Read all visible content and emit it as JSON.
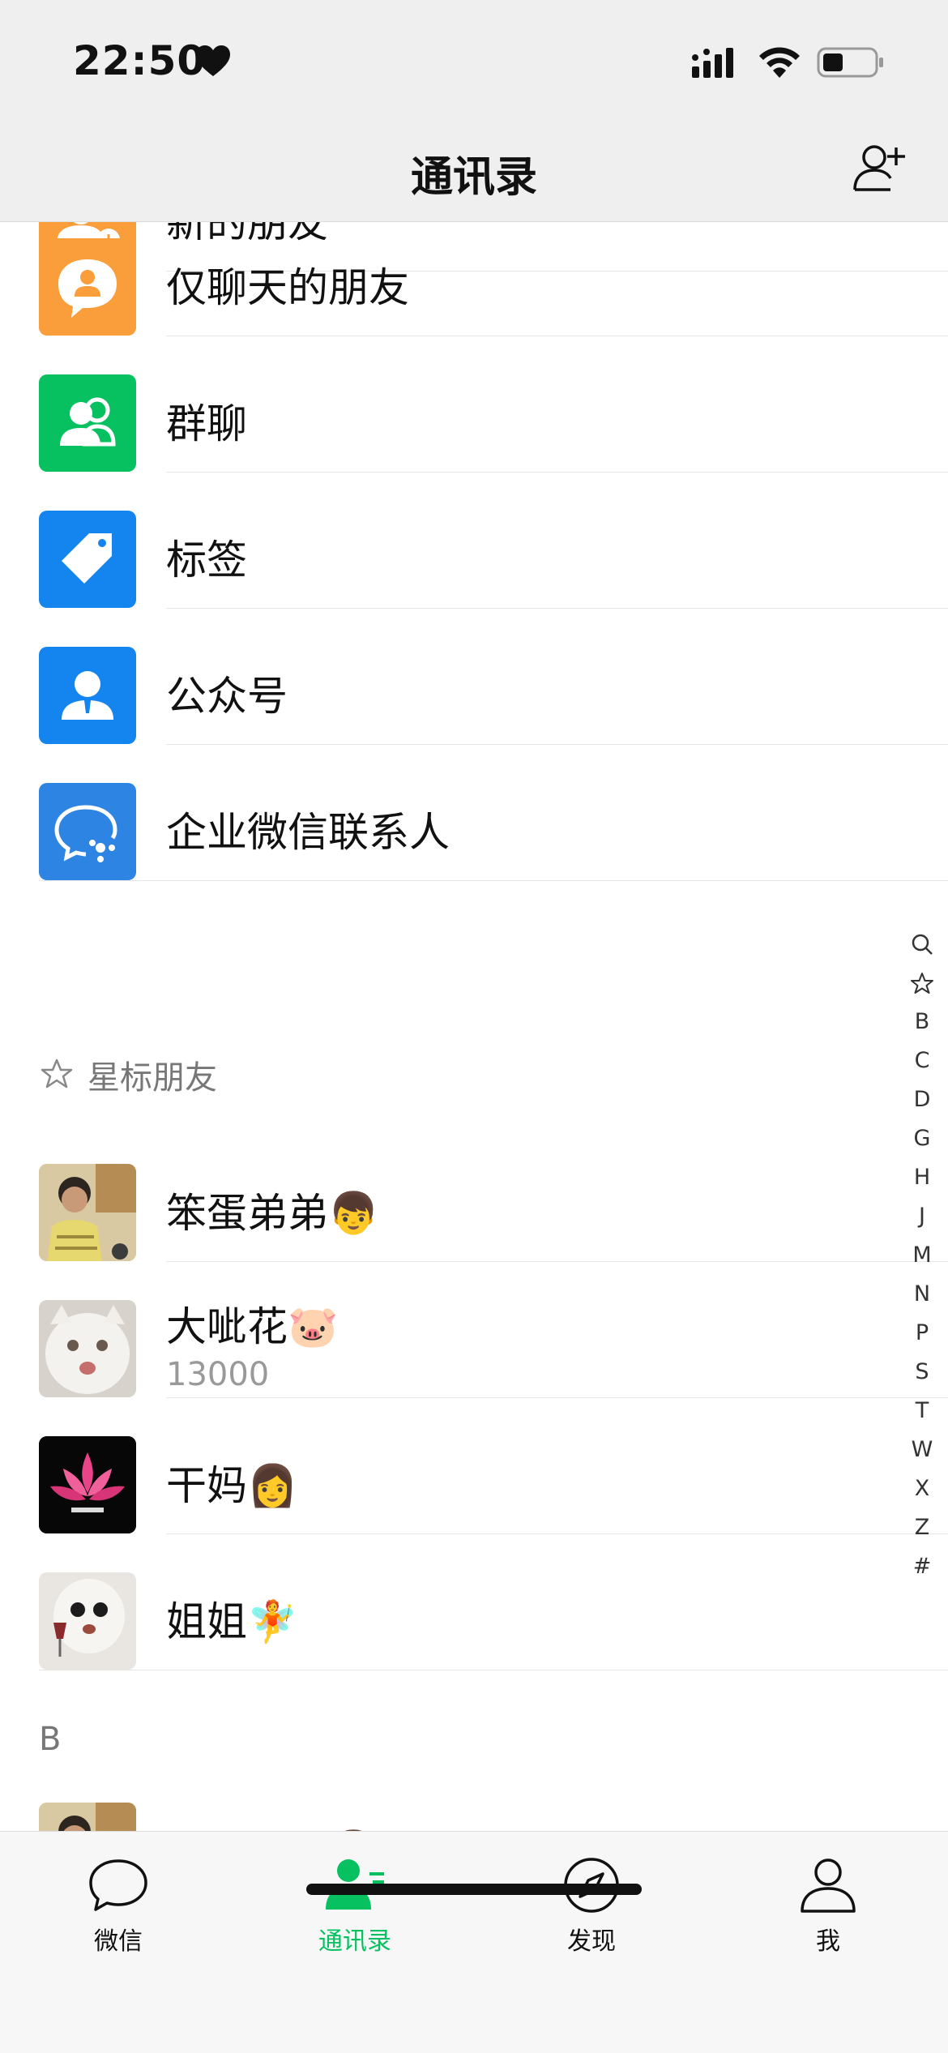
{
  "status_bar": {
    "time": "22:50"
  },
  "nav": {
    "title": "通讯录"
  },
  "functions": [
    {
      "label": "新的朋友",
      "color": "#fa9d3b",
      "icon": "new-friend-icon"
    },
    {
      "label": "仅聊天的朋友",
      "color": "#fa9d3b",
      "icon": "chat-only-icon"
    },
    {
      "label": "群聊",
      "color": "#07c160",
      "icon": "group-chat-icon"
    },
    {
      "label": "标签",
      "color": "#1485ee",
      "icon": "tag-icon"
    },
    {
      "label": "公众号",
      "color": "#1485ee",
      "icon": "official-account-icon"
    },
    {
      "label": "企业微信联系人",
      "color": "#2d84e2",
      "icon": "wecom-contacts-icon"
    }
  ],
  "starred_section": {
    "title": "星标朋友"
  },
  "starred": [
    {
      "name": "笨蛋弟弟👦"
    },
    {
      "name": "大呲花🐷",
      "remark": "13000"
    },
    {
      "name": "干妈👩"
    },
    {
      "name": "姐姐🧚"
    }
  ],
  "section_b": {
    "title": "B",
    "first_contact": "笨蛋弟弟👦"
  },
  "index_letters": [
    "B",
    "C",
    "D",
    "G",
    "H",
    "J",
    "M",
    "N",
    "P",
    "S",
    "T",
    "W",
    "X",
    "Z",
    "#"
  ],
  "tabs": [
    {
      "label": "微信",
      "icon": "chat-bubble-icon"
    },
    {
      "label": "通讯录",
      "icon": "contacts-icon",
      "active": true
    },
    {
      "label": "发现",
      "icon": "compass-icon"
    },
    {
      "label": "我",
      "icon": "profile-icon"
    }
  ],
  "colors": {
    "accent": "#07c160",
    "orange": "#fa9d3b",
    "blue": "#1485ee"
  }
}
